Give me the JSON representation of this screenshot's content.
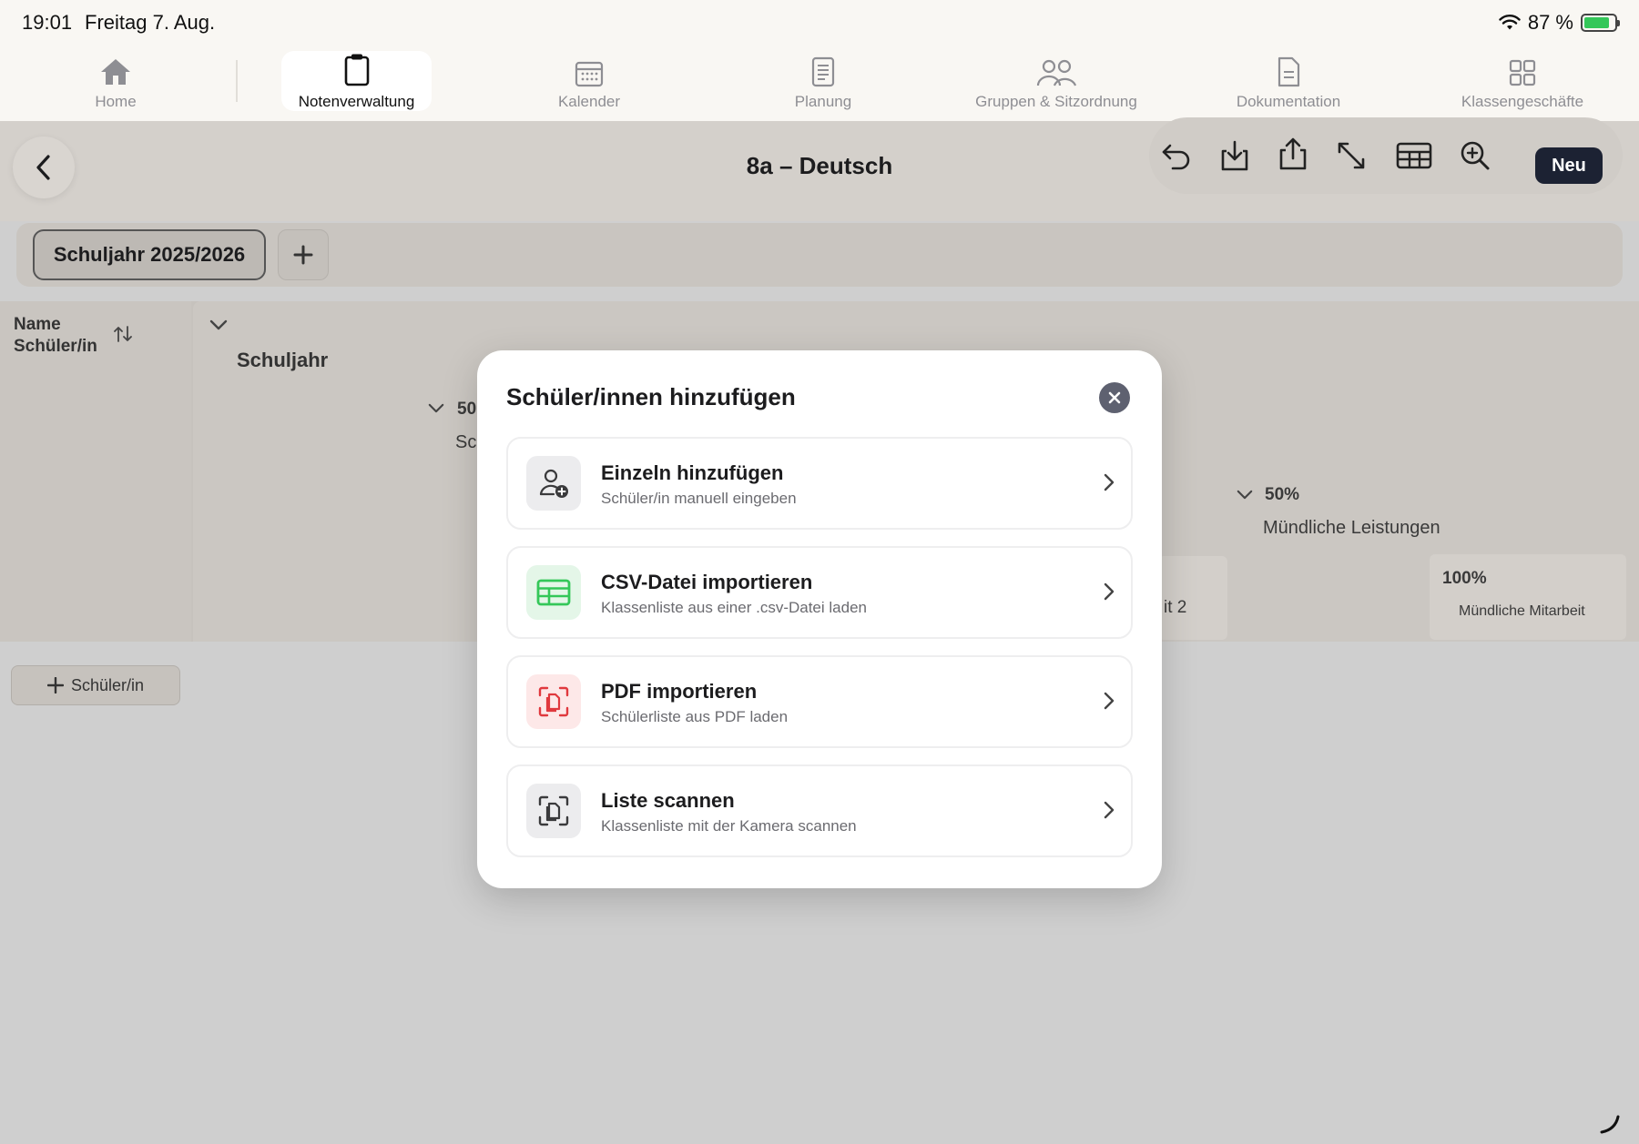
{
  "status": {
    "time": "19:01",
    "date": "Freitag 7. Aug.",
    "battery": "87 %"
  },
  "nav": {
    "home": "Home",
    "notenverwaltung": "Notenverwaltung",
    "kalender": "Kalender",
    "planung": "Planung",
    "gruppen": "Gruppen & Sitzordnung",
    "dokumentation": "Dokumentation",
    "klassengeschaefte": "Klassengeschäfte"
  },
  "header": {
    "title": "8a – Deutsch",
    "new_label": "Neu"
  },
  "year_bar": {
    "selected": "Schuljahr 2025/2026"
  },
  "grid": {
    "name_header_line1": "Name",
    "name_header_line2": "Schüler/in",
    "schuljahr": "Schuljahr",
    "left_weight_partial": "50",
    "left_name_partial": "Sc",
    "right_weight": "50%",
    "right_name": "Mündliche Leistungen",
    "partial_cell": "it 2",
    "sub_weight": "100%",
    "sub_name": "Mündliche Mitarbeit"
  },
  "add_student_label": "Schüler/in",
  "modal": {
    "title": "Schüler/innen hinzufügen",
    "options": [
      {
        "title": "Einzeln hinzufügen",
        "subtitle": "Schüler/in manuell eingeben",
        "icon": "person-add-icon",
        "accent": "#3a3a3c"
      },
      {
        "title": "CSV-Datei importieren",
        "subtitle": "Klassenliste aus einer .csv-Datei laden",
        "icon": "table-icon",
        "accent": "#34c759"
      },
      {
        "title": "PDF importieren",
        "subtitle": "Schülerliste aus PDF laden",
        "icon": "pdf-scan-icon",
        "accent": "#e0393e"
      },
      {
        "title": "Liste scannen",
        "subtitle": "Klassenliste mit der Kamera scannen",
        "icon": "document-scan-icon",
        "accent": "#3a3a3c"
      }
    ]
  },
  "colors": {
    "primary_dark": "#1c2233",
    "overlay": "#cfcfcf"
  }
}
